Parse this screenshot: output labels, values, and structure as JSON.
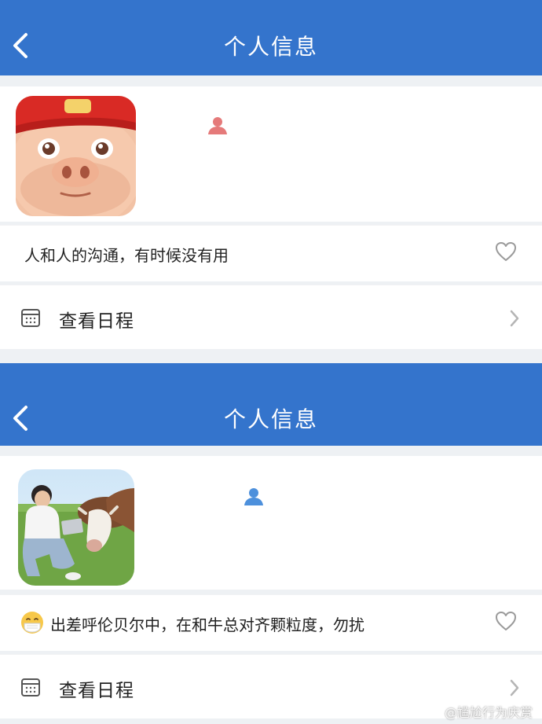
{
  "screens": [
    {
      "nav": {
        "title": "个人信息"
      },
      "status": "人和人的沟通，有时候没有用",
      "schedule": {
        "label": "查看日程"
      }
    },
    {
      "nav": {
        "title": "个人信息"
      },
      "status": "出差呼伦贝尔中，在和牛总对齐颗粒度，勿扰",
      "schedule": {
        "label": "查看日程"
      }
    }
  ],
  "watermark": "@尴尬行为庆赏",
  "colors": {
    "navbar": "#3474cc",
    "person_icon_1": "#e57a7a",
    "person_icon_2": "#4d90dc"
  },
  "icons": [
    "back-arrow-icon",
    "person-icon",
    "heart-icon",
    "calendar-icon",
    "chevron-right-icon",
    "mask-face-emoji",
    "weibo-logo-icon"
  ]
}
